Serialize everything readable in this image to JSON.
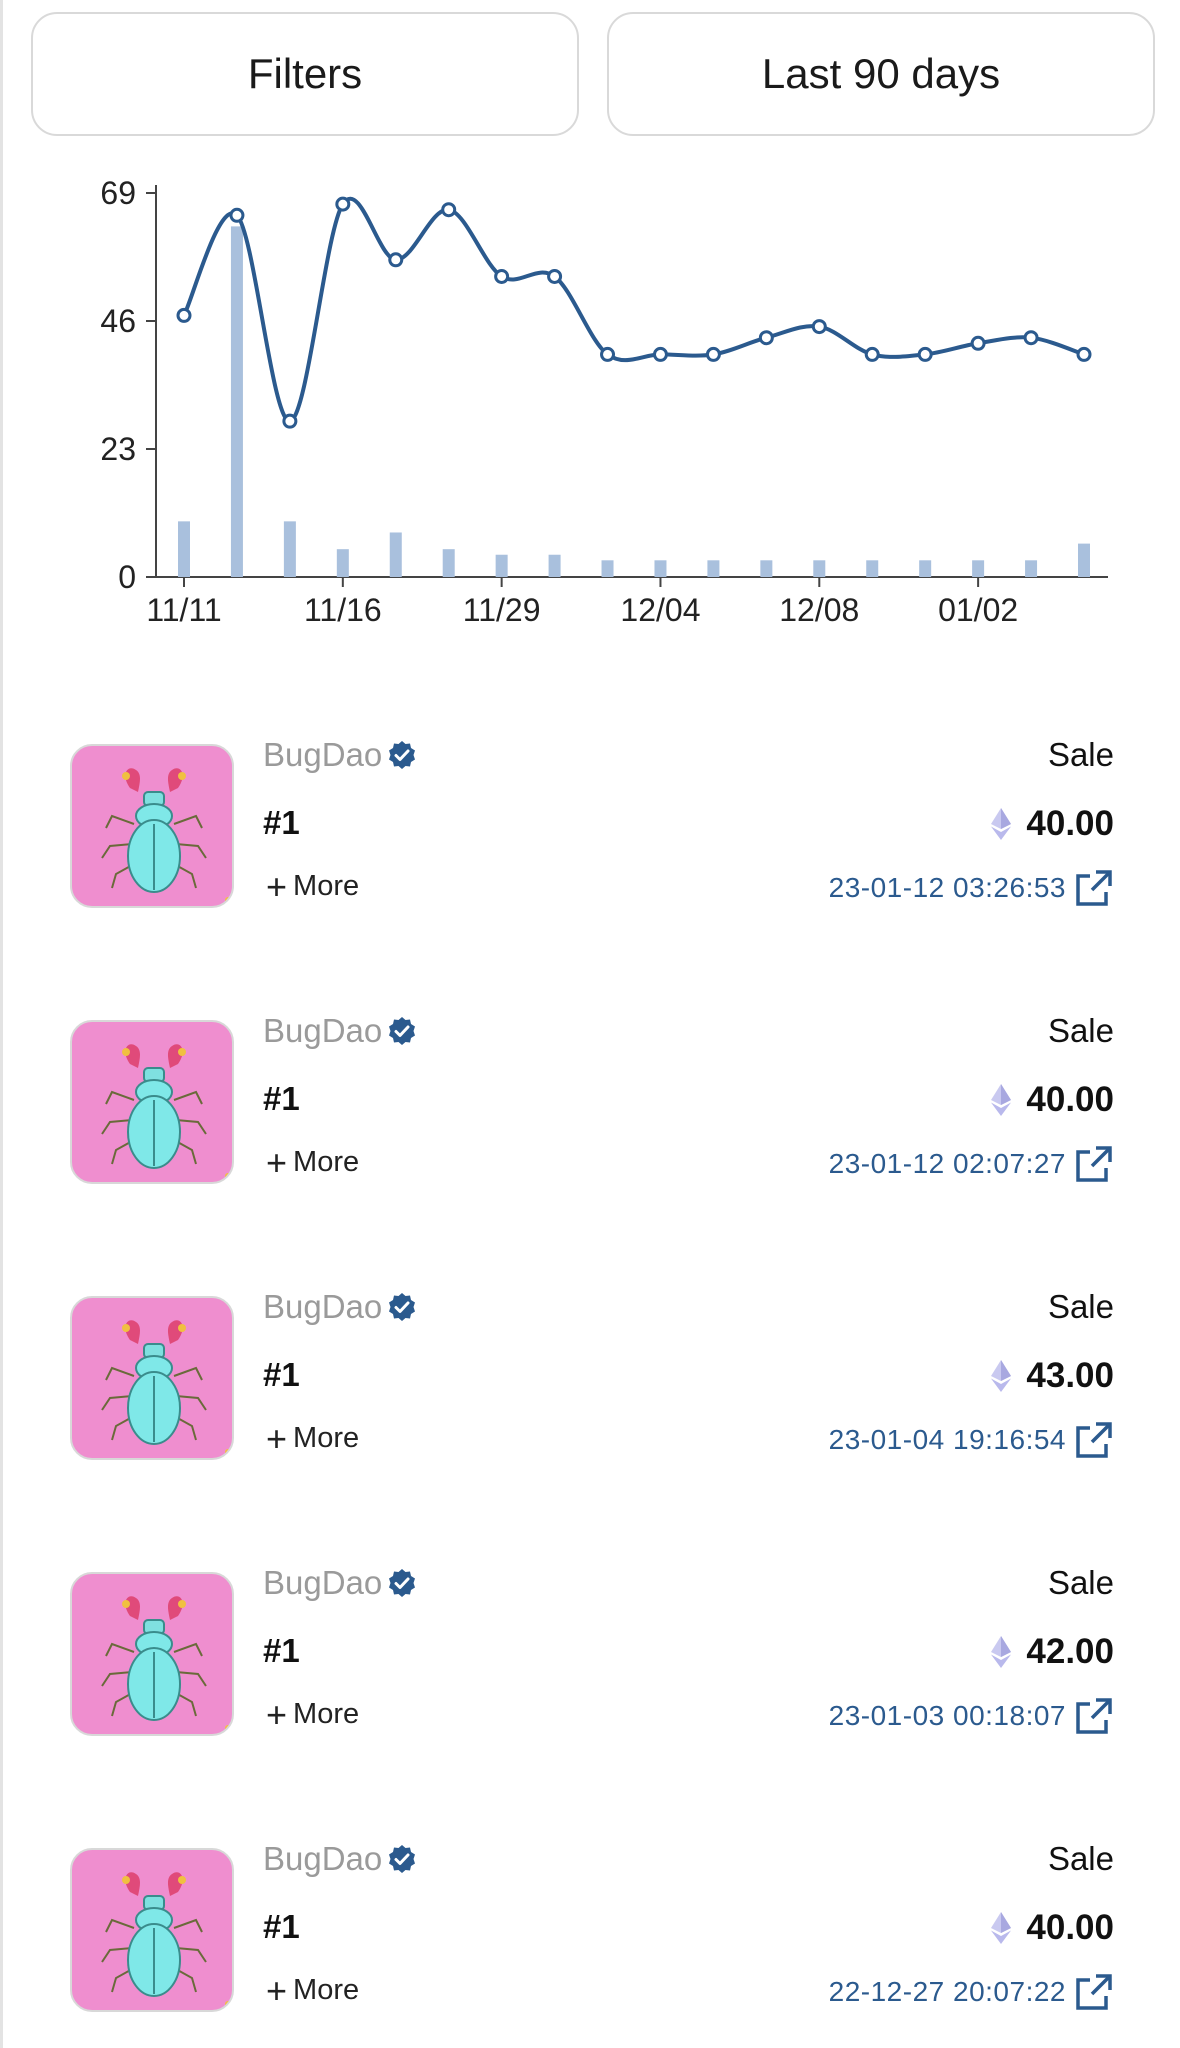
{
  "toolbar": {
    "filters_label": "Filters",
    "range_label": "Last 90 days"
  },
  "chart_data": {
    "type": "line+bar",
    "x_tick_labels": [
      "11/11",
      "11/16",
      "11/29",
      "12/04",
      "12/08",
      "01/02"
    ],
    "y_ticks": [
      0,
      23,
      46,
      69
    ],
    "ylim": [
      0,
      69
    ],
    "line_color": "#2b5a8e",
    "bar_color": "#a9c0dd",
    "series": [
      {
        "kind": "line",
        "values": [
          47,
          65,
          28,
          67,
          57,
          66,
          54,
          54,
          40,
          40,
          40,
          43,
          45,
          40,
          40,
          42,
          43,
          40
        ]
      },
      {
        "kind": "bar",
        "values": [
          10,
          63,
          10,
          5,
          8,
          5,
          4,
          4,
          3,
          3,
          3,
          3,
          3,
          3,
          3,
          3,
          3,
          6
        ]
      }
    ]
  },
  "activity": [
    {
      "collection": "BugDao",
      "token": "#1",
      "more_label": "More",
      "event": "Sale",
      "price": "40.00",
      "date": "23-01-12 03:26:53"
    },
    {
      "collection": "BugDao",
      "token": "#1",
      "more_label": "More",
      "event": "Sale",
      "price": "40.00",
      "date": "23-01-12 02:07:27"
    },
    {
      "collection": "BugDao",
      "token": "#1",
      "more_label": "More",
      "event": "Sale",
      "price": "43.00",
      "date": "23-01-04 19:16:54"
    },
    {
      "collection": "BugDao",
      "token": "#1",
      "more_label": "More",
      "event": "Sale",
      "price": "42.00",
      "date": "23-01-03 00:18:07"
    },
    {
      "collection": "BugDao",
      "token": "#1",
      "more_label": "More",
      "event": "Sale",
      "price": "40.00",
      "date": "22-12-27 20:07:22"
    }
  ],
  "icons": {
    "verified": "verified-badge-icon",
    "currency": "ethereum-icon",
    "external": "external-link-icon",
    "more": "plus-icon"
  },
  "colors": {
    "accent": "#2b5a8e",
    "thumbnail_bg": "#ef8ecf"
  }
}
